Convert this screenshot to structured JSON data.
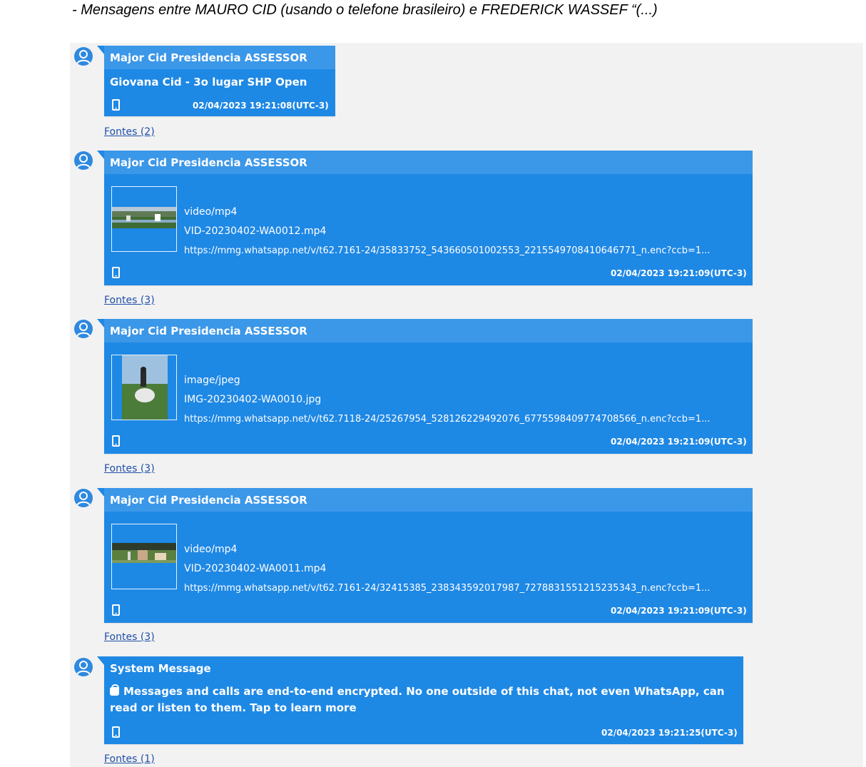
{
  "caption": "- Mensagens entre MAURO CID (usando o telefone brasileiro) e FREDERICK WASSEF “(...)",
  "messages": [
    {
      "sender": "Major Cid Presidencia ASSESSOR",
      "text": "Giovana Cid - 3o lugar SHP Open",
      "timestamp": "02/04/2023 19:21:08(UTC-3)",
      "sources": "Fontes (2)"
    },
    {
      "sender": "Major Cid Presidencia ASSESSOR",
      "mime": "video/mp4",
      "filename": "VID-20230402-WA0012.mp4",
      "url": "https://mmg.whatsapp.net/v/t62.7161-24/35833752_543660501002553_2215549708410646771_n.enc?ccb=1...",
      "timestamp": "02/04/2023 19:21:09(UTC-3)",
      "sources": "Fontes (3)"
    },
    {
      "sender": "Major Cid Presidencia ASSESSOR",
      "mime": "image/jpeg",
      "filename": "IMG-20230402-WA0010.jpg",
      "url": "https://mmg.whatsapp.net/v/t62.7118-24/25267954_528126229492076_6775598409774708566_n.enc?ccb=1...",
      "timestamp": "02/04/2023 19:21:09(UTC-3)",
      "sources": "Fontes (3)"
    },
    {
      "sender": "Major Cid Presidencia ASSESSOR",
      "mime": "video/mp4",
      "filename": "VID-20230402-WA0011.mp4",
      "url": "https://mmg.whatsapp.net/v/t62.7161-24/32415385_238343592017987_7278831551215235343_n.enc?ccb=1...",
      "timestamp": "02/04/2023 19:21:09(UTC-3)",
      "sources": "Fontes (3)"
    },
    {
      "sender": "System Message",
      "text": "Messages and calls are end-to-end encrypted. No one outside of this chat, not even WhatsApp, can read or listen to them. Tap to learn more",
      "timestamp": "02/04/2023 19:21:25(UTC-3)",
      "sources": "Fontes (1)"
    }
  ],
  "icons": {
    "avatar": "user-avatar-icon",
    "device": "phone-icon",
    "lock": "lock-icon"
  },
  "colors": {
    "bubble": "#1e88e5",
    "header": "#3b97e8",
    "link": "#1f4fa8",
    "panel": "#f2f2f2"
  }
}
